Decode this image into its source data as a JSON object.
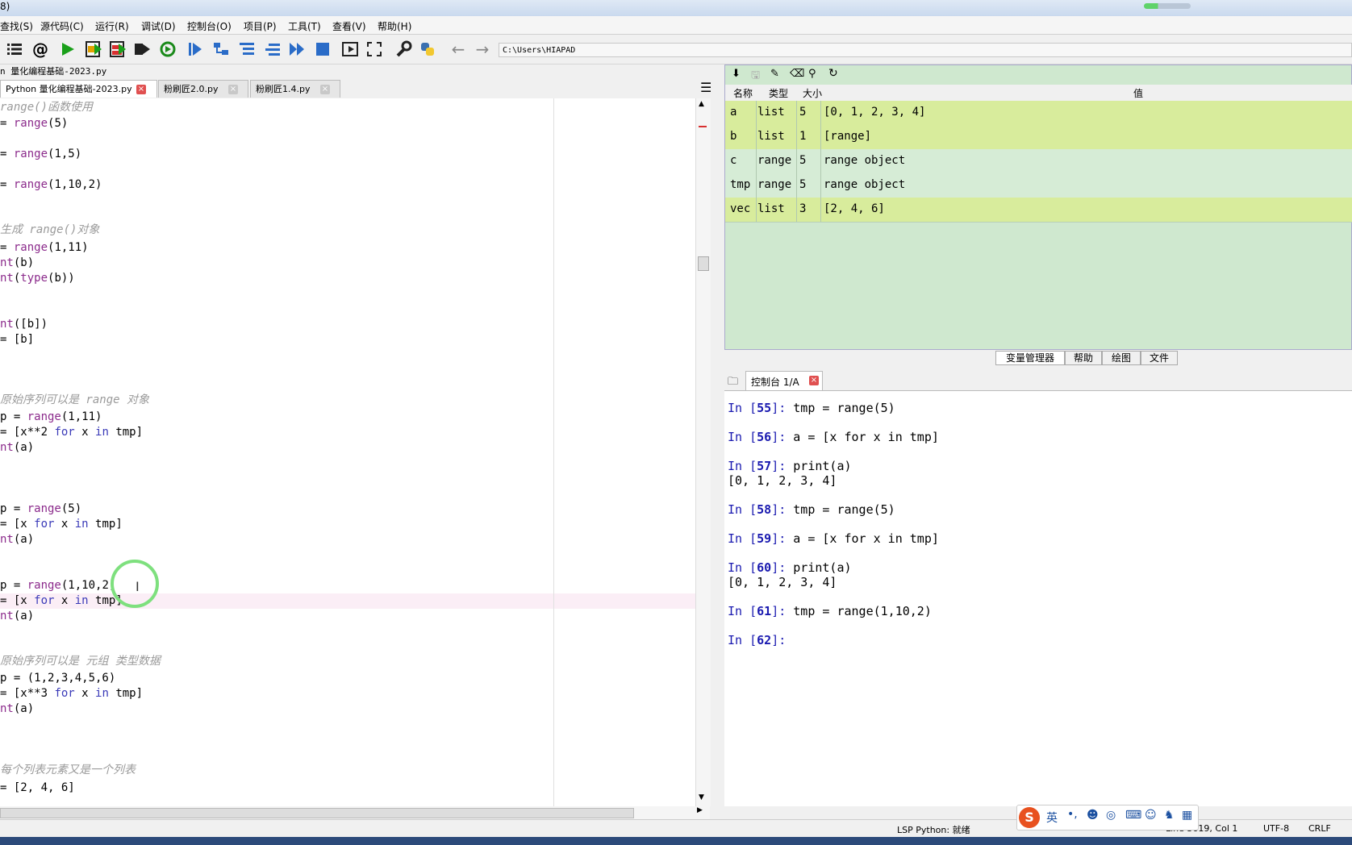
{
  "window": {
    "title": "8)"
  },
  "menu": [
    "查找(S)",
    "源代码(C)",
    "运行(R)",
    "调试(D)",
    "控制台(O)",
    "项目(P)",
    "工具(T)",
    "查看(V)",
    "帮助(H)"
  ],
  "toolbar": {
    "path": "C:\\Users\\HIAPAD"
  },
  "editor": {
    "file_path_label": "n 量化编程基础-2023.py",
    "tabs": [
      {
        "label": "Python 量化编程基础-2023.py"
      },
      {
        "label": "粉刷匠2.0.py"
      },
      {
        "label": "粉刷匠1.4.py"
      }
    ],
    "lines": [
      "range()函数使用",
      "= range(5)",
      "= range(1,5)",
      "= range(1,10,2)",
      "生成 range()对象",
      "= range(1,11)",
      "nt(b)",
      "nt(type(b))",
      "nt([b])",
      "= [b]",
      "原始序列可以是 range 对象",
      "p = range(1,11)",
      "= [x**2 for x in tmp]",
      "nt(a)",
      "p = range(5)",
      "= [x for x in tmp]",
      "nt(a)",
      "p = range(1,10,2)",
      "= [x for x in tmp]",
      "nt(a)",
      "原始序列可以是 元组 类型数据",
      "p = (1,2,3,4,5,6)",
      "= [x**3 for x in tmp]",
      "nt(a)",
      "每个列表元素又是一个列表",
      "= [2, 4, 6]"
    ]
  },
  "variables": {
    "headers": {
      "name": "名称",
      "type": "类型",
      "size": "大小",
      "value": "值"
    },
    "rows": [
      {
        "name": "a",
        "type": "list",
        "size": "5",
        "value": "[0, 1, 2, 3, 4]",
        "color": "#d8ec9c"
      },
      {
        "name": "b",
        "type": "list",
        "size": "1",
        "value": "[range]",
        "color": "#d8ec9c"
      },
      {
        "name": "c",
        "type": "range",
        "size": "5",
        "value": "range object",
        "color": "#d6ecd6"
      },
      {
        "name": "tmp",
        "type": "range",
        "size": "5",
        "value": "range object",
        "color": "#d6ecd6"
      },
      {
        "name": "vec",
        "type": "list",
        "size": "3",
        "value": "[2, 4, 6]",
        "color": "#d8ec9c"
      }
    ]
  },
  "panel_tabs": [
    "变量管理器",
    "帮助",
    "绘图",
    "文件"
  ],
  "console": {
    "tab_label": "控制台 1/A",
    "entries": [
      {
        "n": "55",
        "code": "tmp = range(5)"
      },
      {
        "n": "56",
        "code": "a = [x for x in tmp]"
      },
      {
        "n": "57",
        "code": "print(a)",
        "out": "[0, 1, 2, 3, 4]"
      },
      {
        "n": "58",
        "code": "tmp = range(5)"
      },
      {
        "n": "59",
        "code": "a = [x for x in tmp]"
      },
      {
        "n": "60",
        "code": "print(a)",
        "out": "[0, 1, 2, 3, 4]"
      },
      {
        "n": "61",
        "code": "tmp = range(1,10,2)"
      },
      {
        "n": "62",
        "code": ""
      }
    ]
  },
  "status": {
    "lsp": "LSP Python: 就绪",
    "position": "Line 3619, Col 1",
    "encoding": "UTF-8",
    "eol": "CRLF"
  },
  "ime": {
    "lang": "英"
  }
}
